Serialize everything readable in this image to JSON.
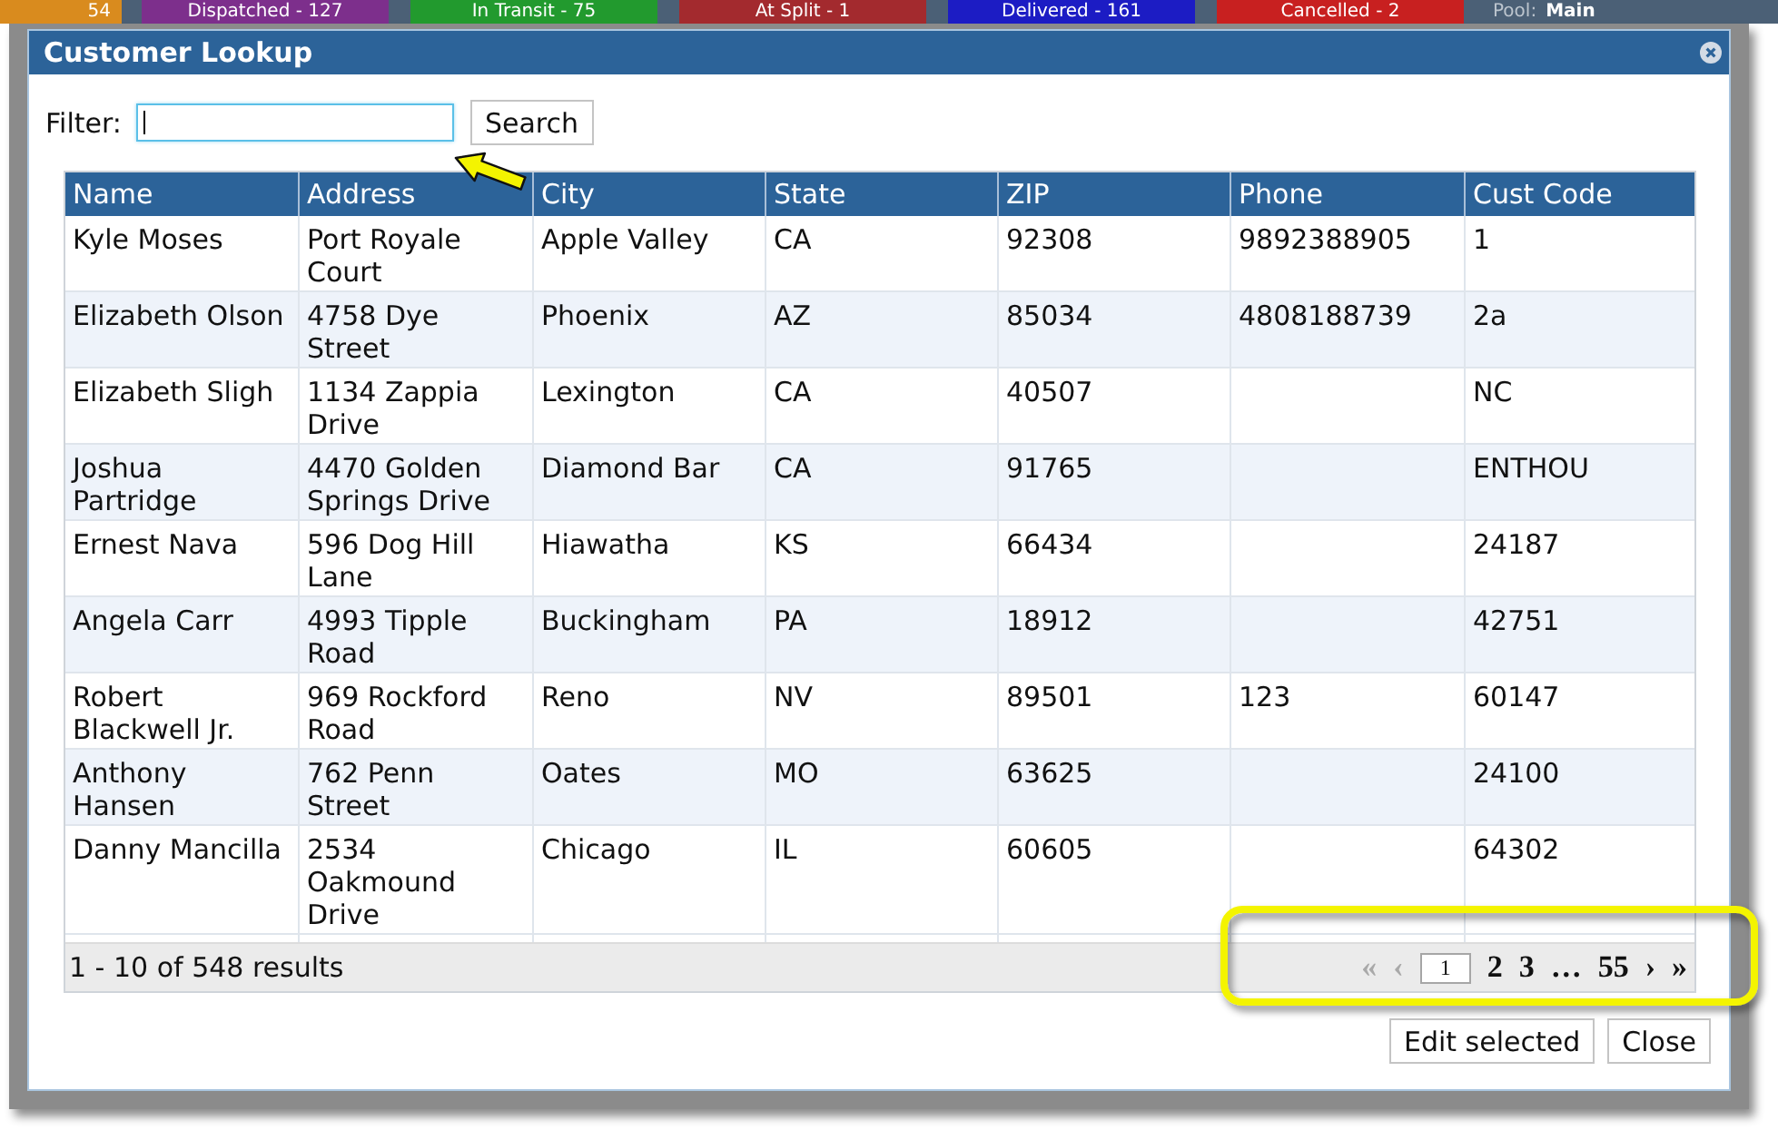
{
  "status_tabs": [
    {
      "label": "54",
      "color": "#d98b1e"
    },
    {
      "label": "Dispatched - 127",
      "color": "#7d2f8c"
    },
    {
      "label": "In Transit - 75",
      "color": "#229a2e"
    },
    {
      "label": "At Split - 1",
      "color": "#a32a2e"
    },
    {
      "label": "Delivered - 161",
      "color": "#1c1cc4"
    },
    {
      "label": "Cancelled - 2",
      "color": "#c82020"
    }
  ],
  "pool": {
    "label": "Pool:",
    "value": "Main"
  },
  "dialog": {
    "title": "Customer Lookup",
    "filter": {
      "label": "Filter:",
      "focused": true
    },
    "search_button": "Search",
    "table": {
      "columns": [
        "Name",
        "Address",
        "City",
        "State",
        "ZIP",
        "Phone",
        "Cust Code"
      ],
      "rows": [
        {
          "name": "Kyle Moses",
          "address": "Port Royale Court",
          "city": "Apple Valley",
          "state": "CA",
          "zip": "92308",
          "phone": "9892388905",
          "cust_code": "1",
          "selected": false
        },
        {
          "name": "Elizabeth Olson",
          "address": "4758 Dye Street",
          "city": "Phoenix",
          "state": "AZ",
          "zip": "85034",
          "phone": "4808188739",
          "cust_code": "2a",
          "selected": false
        },
        {
          "name": "Elizabeth Sligh",
          "address": "1134 Zappia Drive",
          "city": "Lexington",
          "state": "CA",
          "zip": "40507",
          "cust_code": "NC",
          "selected": false
        },
        {
          "name": "Joshua Partridge",
          "address": "4470 Golden Springs Drive",
          "city": "Diamond Bar",
          "state": "CA",
          "zip": "91765",
          "cust_code": "ENTHOU",
          "selected": false
        },
        {
          "name": "Ernest Nava",
          "address": "596 Dog Hill Lane",
          "city": "Hiawatha",
          "state": "KS",
          "zip": "66434",
          "cust_code": "24187",
          "selected": false
        },
        {
          "name": "Angela Carr",
          "address": "4993 Tipple Road",
          "city": "Buckingham",
          "state": "PA",
          "zip": "18912",
          "cust_code": "42751",
          "selected": false
        },
        {
          "name": "Robert Blackwell Jr.",
          "address": "969 Rockford Road",
          "city": "Reno",
          "state": "NV",
          "zip": "89501",
          "phone": "123",
          "cust_code": "60147",
          "selected": false
        },
        {
          "name": "Anthony Hansen",
          "address": "762 Penn Street",
          "city": "Oates",
          "state": "MO",
          "zip": "63625",
          "cust_code": "24100",
          "selected": false
        },
        {
          "name": "Danny Mancilla",
          "address": "2534 Oakmound Drive",
          "city": "Chicago",
          "state": "IL",
          "zip": "60605",
          "cust_code": "64302",
          "selected": false
        }
      ]
    },
    "footer": {
      "summary": "1 - 10 of 548 results",
      "pager": {
        "first": {
          "label": "«",
          "disabled": true
        },
        "previous": {
          "label": "‹",
          "disabled": true
        },
        "pages": [
          {
            "label": "1",
            "selected": true
          },
          {
            "label": "2",
            "selected": false
          },
          {
            "label": "3",
            "selected": false
          },
          {
            "label": "…",
            "selected": false
          },
          {
            "label": "55",
            "selected": false
          }
        ],
        "next": {
          "label": "›",
          "disabled": false
        },
        "last": {
          "label": "»",
          "disabled": false
        }
      }
    },
    "buttons": [
      "Edit selected",
      "Close"
    ]
  }
}
